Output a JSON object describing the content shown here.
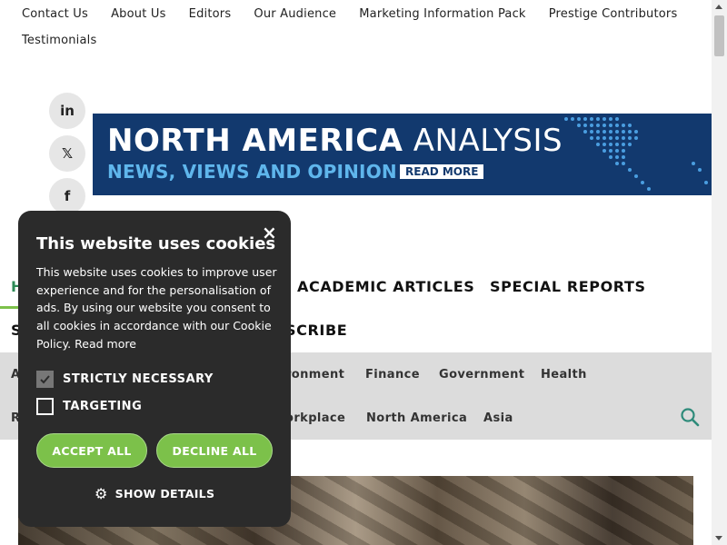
{
  "top_links": [
    "Contact Us",
    "About Us",
    "Editors",
    "Our Audience",
    "Marketing Information Pack",
    "Prestige Contributors",
    "Testimonials"
  ],
  "social": {
    "linkedin": "in",
    "x": "𝕏",
    "facebook": "f"
  },
  "banner": {
    "title_bold": "NORTH AMERICA",
    "title_light": "ANALYSIS",
    "subtitle": "NEWS, VIEWS AND OPINION",
    "read_more": "READ MORE",
    "bg_color": "#12396e",
    "accent_color": "#5fb6ec"
  },
  "main_nav": {
    "home_partial": "H",
    "academic": "ACADEMIC ARTICLES",
    "special": "SPECIAL REPORTS",
    "s_partial": "S",
    "subscribe_partial": "SCRIBE"
  },
  "sub_nav": {
    "a_partial": "A",
    "environment_partial": "ronment",
    "finance": "Finance",
    "government": "Government",
    "health": "Health",
    "r_partial": "R",
    "workplace_partial": "orkplace",
    "north_america": "North America",
    "asia": "Asia"
  },
  "cookie": {
    "close": "×",
    "title": "This website uses cookies",
    "body": "This website uses cookies to improve user experience and for the personalisation of ads. By using our website you consent to all cookies in accordance with our Cookie Policy.",
    "read_more": "Read more",
    "strictly": "STRICTLY NECESSARY",
    "targeting": "TARGETING",
    "accept": "ACCEPT ALL",
    "decline": "DECLINE ALL",
    "details": "SHOW DETAILS",
    "accent": "#7cc14a"
  }
}
